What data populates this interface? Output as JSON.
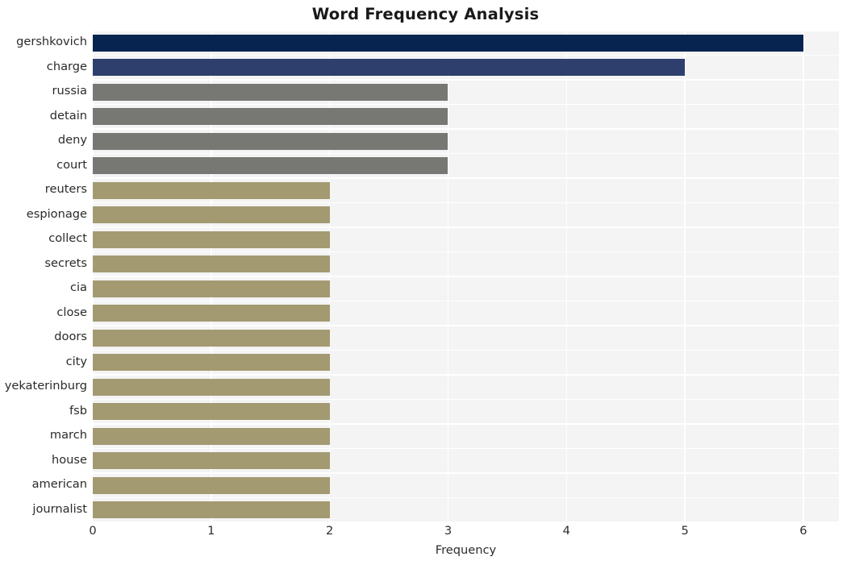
{
  "chart_data": {
    "type": "bar",
    "orientation": "horizontal",
    "title": "Word Frequency Analysis",
    "xlabel": "Frequency",
    "ylabel": "",
    "xlim": [
      0,
      6.3
    ],
    "xticks": [
      0,
      1,
      2,
      3,
      4,
      5,
      6
    ],
    "xtick_labels": [
      "0",
      "1",
      "2",
      "3",
      "4",
      "5",
      "6"
    ],
    "grid": true,
    "legend": null,
    "categories": [
      "gershkovich",
      "charge",
      "russia",
      "detain",
      "deny",
      "court",
      "reuters",
      "espionage",
      "collect",
      "secrets",
      "cia",
      "close",
      "doors",
      "city",
      "yekaterinburg",
      "fsb",
      "march",
      "house",
      "american",
      "journalist"
    ],
    "values": [
      6,
      5,
      3,
      3,
      3,
      3,
      2,
      2,
      2,
      2,
      2,
      2,
      2,
      2,
      2,
      2,
      2,
      2,
      2,
      2
    ],
    "bar_colors": [
      "#06244f",
      "#2e3f6e",
      "#777774",
      "#777774",
      "#777774",
      "#777774",
      "#a39a72",
      "#a39a72",
      "#a39a72",
      "#a39a72",
      "#a39a72",
      "#a39a72",
      "#a39a72",
      "#a39a72",
      "#a39a72",
      "#a39a72",
      "#a39a72",
      "#a39a72",
      "#a39a72",
      "#a39a72"
    ],
    "plot_background": "#f4f4f5",
    "grid_color": "#ffffff",
    "figure_background": "#ffffff"
  }
}
